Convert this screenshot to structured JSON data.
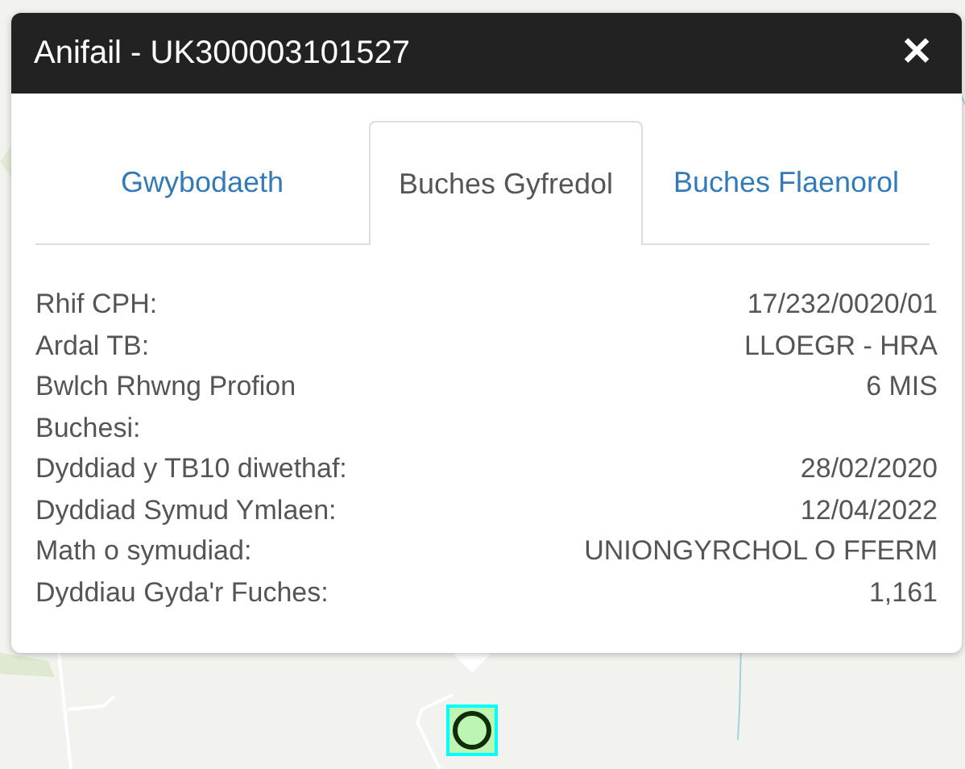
{
  "popup": {
    "title": "Anifail - UK300003101527",
    "close": "✕"
  },
  "tabs": [
    {
      "label": "Gwybodaeth",
      "selected": false
    },
    {
      "label": "Buches Gyfredol",
      "selected": true
    },
    {
      "label": "Buches Flaenorol",
      "selected": false
    }
  ],
  "details": [
    {
      "label": "Rhif CPH:",
      "value": "17/232/0020/01"
    },
    {
      "label": "Ardal TB:",
      "value": "LLOEGR - HRA"
    },
    {
      "label": "Bwlch Rhwng Profion Buchesi:",
      "value": "6 MIS"
    },
    {
      "label": "Dyddiad y TB10 diwethaf:",
      "value": "28/02/2020"
    },
    {
      "label": "Dyddiad Symud Ymlaen:",
      "value": "12/04/2022"
    },
    {
      "label": "Math o symudiad:",
      "value": "UNIONGYRCHOL O FFERM"
    },
    {
      "label": "Dyddiau Gyda'r Fuches:",
      "value": "1,161"
    }
  ]
}
